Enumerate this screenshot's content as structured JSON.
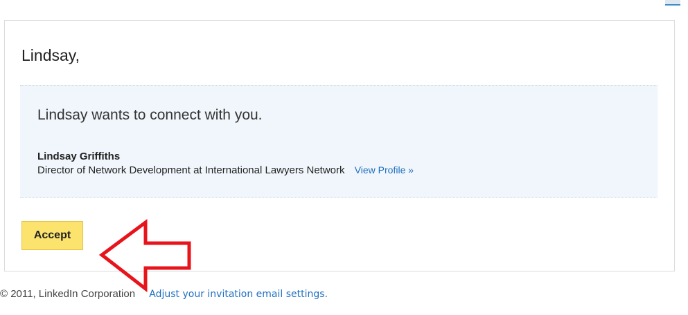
{
  "email": {
    "greeting": "Lindsay,",
    "invitation": {
      "headline": "Lindsay wants to connect with you.",
      "sender_name": "Lindsay Griffiths",
      "sender_title": "Director of Network Development at International Lawyers Network",
      "view_profile_label": "View Profile »"
    },
    "accept_label": "Accept"
  },
  "annotation": {
    "arrow_icon": "left-arrow-outline-icon",
    "arrow_color": "#e8141c"
  },
  "footer": {
    "copyright": "© 2011, LinkedIn Corporation",
    "settings_link": "Adjust your invitation email settings."
  },
  "colors": {
    "accent_link": "#1f6fc0",
    "invite_background": "#f0f6fb",
    "accept_button": "#fbe36d"
  }
}
